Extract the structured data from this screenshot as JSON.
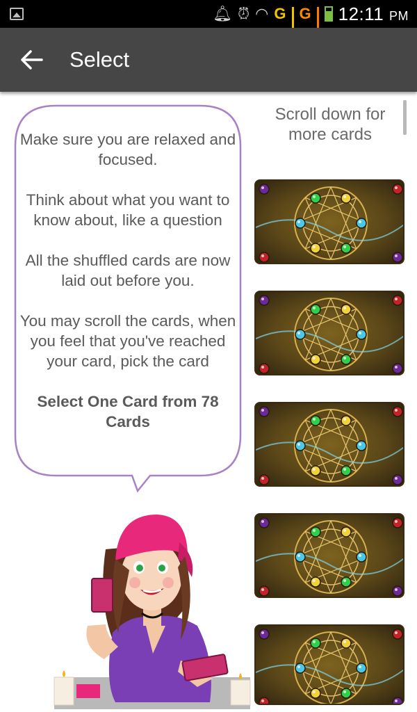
{
  "status_bar": {
    "network_1": "G",
    "network_2": "G",
    "time": "12:11",
    "ampm": "PM"
  },
  "app_bar": {
    "title": "Select",
    "back_icon": "arrow-left-icon"
  },
  "instructions": {
    "paragraphs": [
      "Make sure you are relaxed and focused.",
      "Think about what you want to know about, like a question",
      "All the shuffled cards are now laid out before you.",
      "You may scroll the cards, when you feel that you've reached your card, pick the card"
    ],
    "emphasis": "Select One Card from 78 Cards"
  },
  "scroll_hint": "Scroll down for more cards",
  "cards": [
    {
      "name": "tarot-card-back"
    },
    {
      "name": "tarot-card-back"
    },
    {
      "name": "tarot-card-back"
    },
    {
      "name": "tarot-card-back"
    },
    {
      "name": "tarot-card-back"
    }
  ],
  "colors": {
    "app_bar": "#464646",
    "bubble_border": "#a782c7",
    "card_gold": "#c9a040",
    "hat_pink": "#e8287a",
    "dress_purple": "#7a3fb5"
  }
}
